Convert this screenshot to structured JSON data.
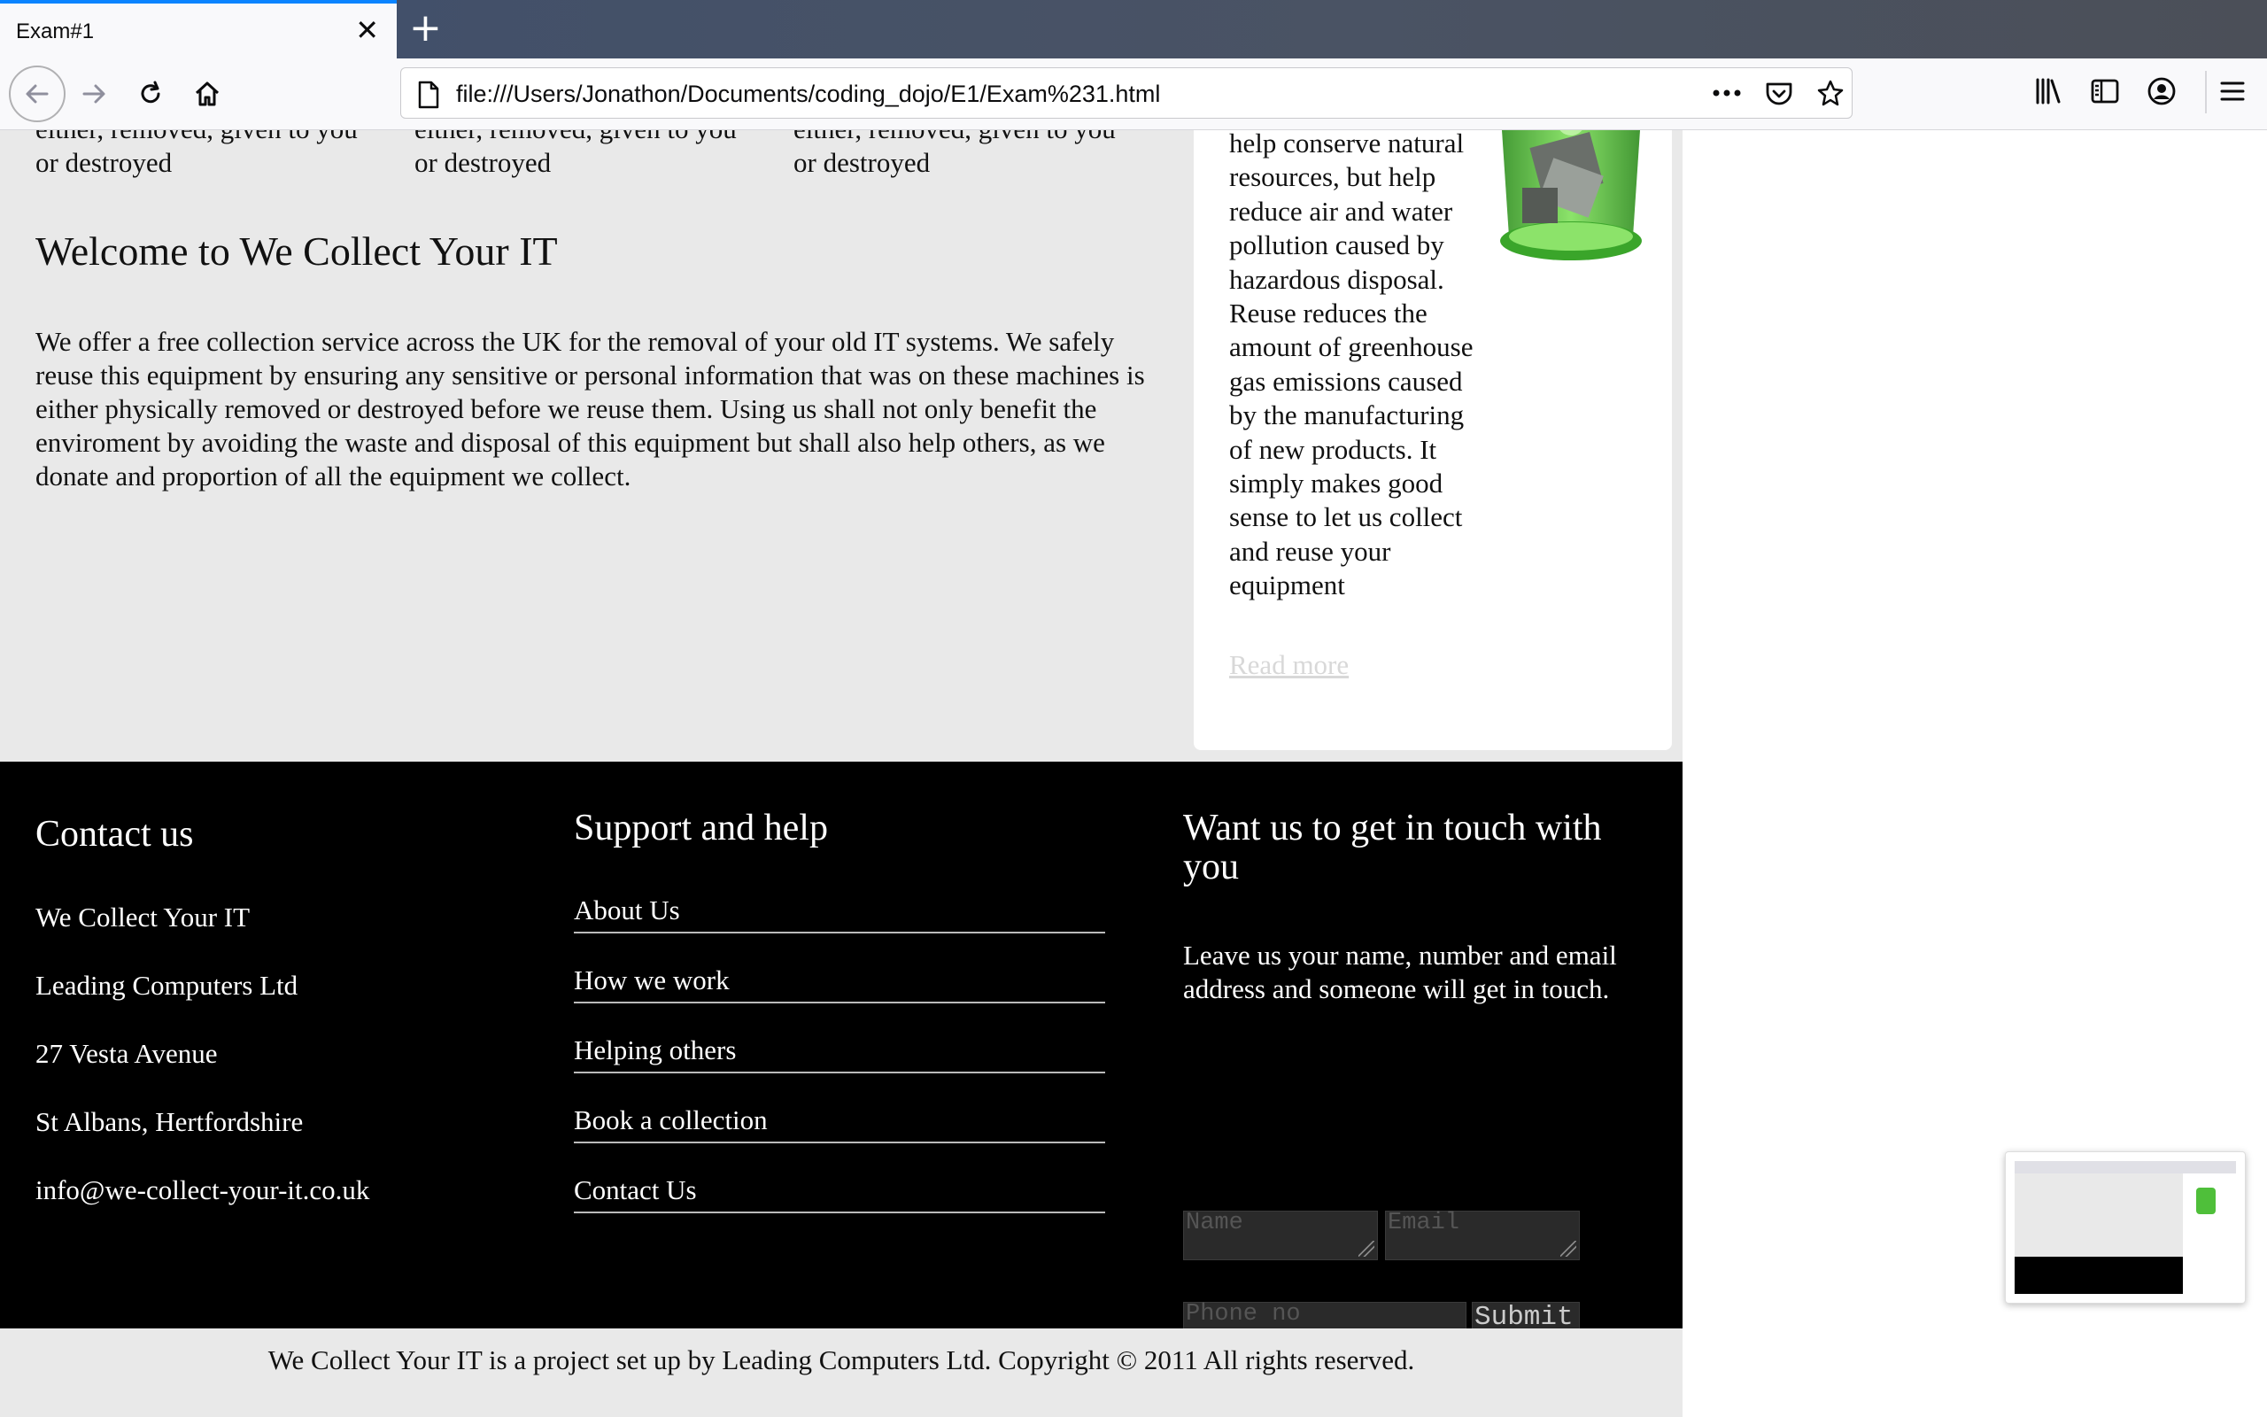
{
  "browser": {
    "tab_title": "Exam#1",
    "url": "file:///Users/Jonathon/Documents/coding_dojo/E1/Exam%231.html"
  },
  "columns": {
    "fragment_line1": "either, removed, given to you",
    "fragment_line2": "or destroyed"
  },
  "welcome": {
    "heading": "Welcome to We Collect Your IT",
    "body": "We offer a free collection service across the UK for the removal of your old IT systems. We safely reuse this equipment by ensuring any sensitive or personal information that was on these machines is either physically removed or destroyed before we reuse them. Using us shall not only benefit the enviroment by avoiding the waste and disposal of this equipment but shall also help others, as we donate and proportion of all the equipment we collect."
  },
  "aside": {
    "text": "help conserve natural resources, but help reduce air and water pollution caused by hazardous disposal. Reuse reduces the amount of greenhouse gas emissions caused by the manufacturing of new products. It simply makes good sense to let us collect and reuse your equipment",
    "read_more": "Read more"
  },
  "footer": {
    "contact_heading": "Contact us",
    "contact_lines": [
      "We Collect Your IT",
      "Leading Computers Ltd",
      "27 Vesta Avenue",
      "St Albans, Hertfordshire",
      "info@we-collect-your-it.co.uk"
    ],
    "support_heading": "Support and help",
    "support_links": [
      "About Us",
      "How we work",
      "Helping others",
      "Book a collection",
      "Contact Us"
    ],
    "touch_heading": "Want us to get in touch with you",
    "touch_text": "Leave us your name, number and email address and someone will get in touch.",
    "name_placeholder": "Name",
    "email_placeholder": "Email",
    "phone_placeholder": "Phone no",
    "submit_label": "Submit"
  },
  "copyright": "We Collect Your IT is a project set up by Leading Computers Ltd. Copyright © 2011 All rights reserved.",
  "colors": {
    "page_bg": "#e9e9e9",
    "footer_bg": "#000000",
    "tab_accent": "#0a84ff"
  }
}
